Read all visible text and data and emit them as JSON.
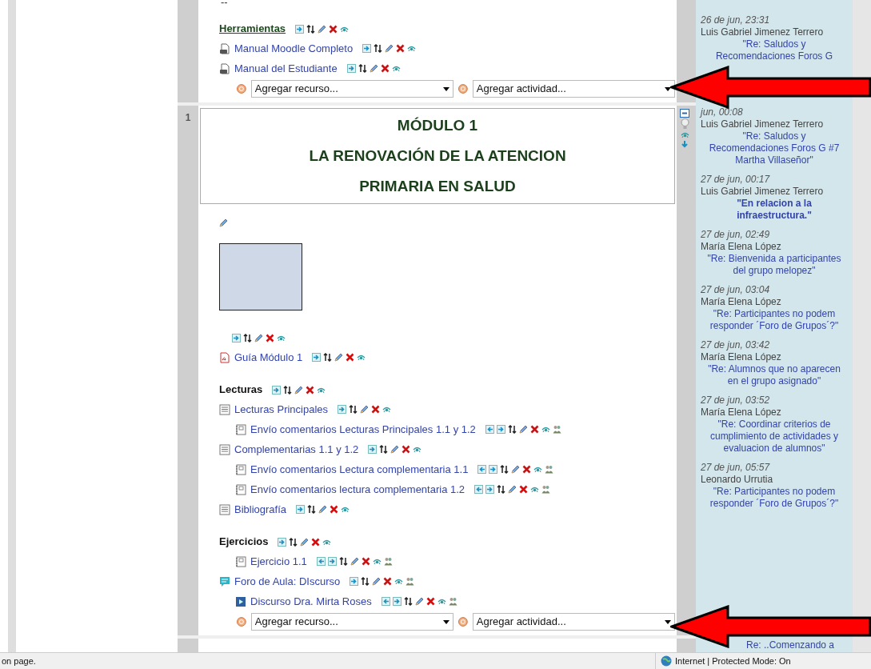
{
  "sections": [
    {
      "summary_text": "--",
      "items": [
        {
          "kind": "heading-link",
          "text": "Herramientas"
        },
        {
          "kind": "file",
          "text": "Manual Moodle Completo"
        },
        {
          "kind": "file",
          "text": "Manual del Estudiante"
        }
      ],
      "add_resource": "Agregar recurso...",
      "add_activity": "Agregar actividad..."
    },
    {
      "number": "1",
      "banner": [
        "MÓDULO 1",
        "LA RENOVACIÓN DE LA ATENCION",
        "PRIMARIA EN SALUD"
      ],
      "items": [
        {
          "kind": "image-label"
        },
        {
          "kind": "pdf",
          "text": "Guía Módulo 1"
        },
        {
          "kind": "heading",
          "text": "Lecturas"
        },
        {
          "kind": "page",
          "text": "Lecturas Principales",
          "children": [
            {
              "kind": "assignment",
              "text": "Envío comentarios Lecturas Principales 1.1 y 1.2"
            }
          ]
        },
        {
          "kind": "page",
          "text": "Complementarias 1.1 y 1.2",
          "children": [
            {
              "kind": "assignment",
              "text": "Envío comentarios Lectura complementaria 1.1"
            },
            {
              "kind": "assignment",
              "text": "Envío comentarios lectura complementaria 1.2"
            }
          ]
        },
        {
          "kind": "page",
          "text": "Bibliografía"
        },
        {
          "kind": "heading",
          "text": "Ejercicios"
        },
        {
          "kind": "assignment",
          "text": "Ejercicio 1.1",
          "nested": true
        },
        {
          "kind": "forum",
          "text": "Foro de Aula: DIscurso",
          "children": [
            {
              "kind": "video",
              "text": "Discurso Dra. Mirta Roses"
            }
          ]
        }
      ],
      "add_resource": "Agregar recurso...",
      "add_activity": "Agregar actividad..."
    }
  ],
  "recent_posts": [
    {
      "date": "26 de jun, 23:31",
      "author": "Luis Gabriel Jimenez Terrero",
      "title": "\"Re: Saludos y Recomendaciones Foros G",
      "bold": false
    },
    {
      "date": "jun, 00:08",
      "author": "Luis Gabriel Jimenez Terrero",
      "title": "\"Re: Saludos y Recomendaciones Foros G #7 Martha Villaseñor\"",
      "bold": false
    },
    {
      "date": "27 de jun, 00:17",
      "author": "Luis Gabriel Jimenez Terrero",
      "title": "\"En relacion a la infraestructura.\"",
      "bold": true
    },
    {
      "date": "27 de jun, 02:49",
      "author": "María Elena López",
      "title": "\"Re: Bienvenida a participantes del grupo melopez\"",
      "bold": false
    },
    {
      "date": "27 de jun, 03:04",
      "author": "María Elena López",
      "title": "\"Re: Participantes no podem responder ´Foro de Grupos´?\"",
      "bold": false
    },
    {
      "date": "27 de jun, 03:42",
      "author": "María Elena López",
      "title": "\"Re: Alumnos que no aparecen en el grupo asignado\"",
      "bold": false
    },
    {
      "date": "27 de jun, 03:52",
      "author": "María Elena López",
      "title": "\"Re: Coordinar criterios de cumplimiento de actividades y evaluacion de alumnos\"",
      "bold": false
    },
    {
      "date": "27 de jun, 05:57",
      "author": "Leonardo Urrutia",
      "title": "\"Re: Participantes no podem responder ´Foro de Grupos´?\"",
      "bold": false
    },
    {
      "title": "Re: ..Comenzando a",
      "bold": false
    }
  ],
  "status_bar": {
    "left": "on page.",
    "zone": "Internet | Protected Mode: On"
  }
}
